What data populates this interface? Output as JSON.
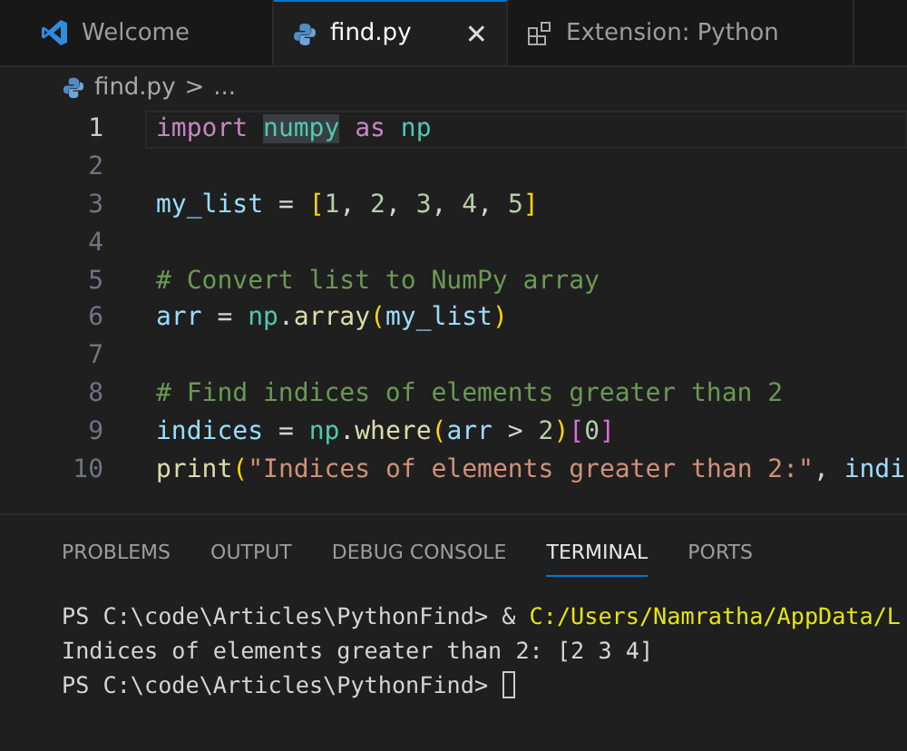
{
  "editor_tabs": [
    {
      "label": "Welcome",
      "selected": false
    },
    {
      "label": "find.py",
      "selected": true,
      "close": "✕"
    },
    {
      "label": "Extension: Python",
      "selected": false
    }
  ],
  "breadcrumb": {
    "file": "find.py",
    "separator": ">",
    "rest": "..."
  },
  "code_lines": [
    {
      "number": "1",
      "current": true,
      "tokens": [
        {
          "kind": "keyword",
          "text": "import "
        },
        {
          "kind": "module",
          "text": "numpy",
          "highlighted": true
        },
        {
          "kind": "keyword",
          "text": " as "
        },
        {
          "kind": "module",
          "text": "np"
        }
      ]
    },
    {
      "number": "2",
      "current": false
    },
    {
      "number": "3",
      "current": false,
      "tokens": [
        {
          "kind": "variable",
          "text": "my_list"
        },
        {
          "kind": "plain",
          "text": " = "
        },
        {
          "kind": "bracket",
          "text": "["
        },
        {
          "kind": "number",
          "text": "1"
        },
        {
          "kind": "plain",
          "text": ", "
        },
        {
          "kind": "number",
          "text": "2"
        },
        {
          "kind": "plain",
          "text": ", "
        },
        {
          "kind": "number",
          "text": "3"
        },
        {
          "kind": "plain",
          "text": ", "
        },
        {
          "kind": "number",
          "text": "4"
        },
        {
          "kind": "plain",
          "text": ", "
        },
        {
          "kind": "number",
          "text": "5"
        },
        {
          "kind": "bracket",
          "text": "]"
        }
      ]
    },
    {
      "number": "4",
      "current": false
    },
    {
      "number": "5",
      "current": false,
      "tokens": [
        {
          "kind": "comment",
          "text": "# Convert list to NumPy array"
        }
      ]
    },
    {
      "number": "6",
      "current": false,
      "tokens": [
        {
          "kind": "variable",
          "text": "arr"
        },
        {
          "kind": "plain",
          "text": " = "
        },
        {
          "kind": "module",
          "text": "np"
        },
        {
          "kind": "plain",
          "text": "."
        },
        {
          "kind": "function",
          "text": "array"
        },
        {
          "kind": "bracket",
          "text": "("
        },
        {
          "kind": "variable",
          "text": "my_list"
        },
        {
          "kind": "bracket",
          "text": ")"
        }
      ]
    },
    {
      "number": "7",
      "current": false
    },
    {
      "number": "8",
      "current": false,
      "tokens": [
        {
          "kind": "comment",
          "text": "# Find indices of elements greater than 2"
        }
      ]
    },
    {
      "number": "9",
      "current": false,
      "tokens": [
        {
          "kind": "variable",
          "text": "indices"
        },
        {
          "kind": "plain",
          "text": " = "
        },
        {
          "kind": "module",
          "text": "np"
        },
        {
          "kind": "plain",
          "text": "."
        },
        {
          "kind": "function",
          "text": "where"
        },
        {
          "kind": "bracket",
          "text": "("
        },
        {
          "kind": "variable",
          "text": "arr"
        },
        {
          "kind": "plain",
          "text": " > "
        },
        {
          "kind": "number",
          "text": "2"
        },
        {
          "kind": "bracket",
          "text": ")"
        },
        {
          "kind": "bracket2",
          "text": "["
        },
        {
          "kind": "number",
          "text": "0"
        },
        {
          "kind": "bracket2",
          "text": "]"
        }
      ]
    },
    {
      "number": "10",
      "current": false,
      "tokens": [
        {
          "kind": "function",
          "text": "print"
        },
        {
          "kind": "bracket",
          "text": "("
        },
        {
          "kind": "string",
          "text": "\"Indices of elements greater than 2:\""
        },
        {
          "kind": "plain",
          "text": ", "
        },
        {
          "kind": "variable",
          "text": "indi"
        }
      ]
    }
  ],
  "panel_tabs": [
    {
      "label": "PROBLEMS",
      "selected": false
    },
    {
      "label": "OUTPUT",
      "selected": false
    },
    {
      "label": "DEBUG CONSOLE",
      "selected": false
    },
    {
      "label": "TERMINAL",
      "selected": true
    },
    {
      "label": "PORTS",
      "selected": false
    }
  ],
  "terminal_lines": [
    {
      "cursor": false,
      "segments": [
        {
          "kind": "plain",
          "text": "PS C:\\code\\Articles\\PythonFind> & "
        },
        {
          "kind": "path",
          "text": "C:/Users/Namratha/AppData/L"
        }
      ]
    },
    {
      "cursor": false,
      "segments": [
        {
          "kind": "plain",
          "text": "Indices of elements greater than 2: [2 3 4]"
        }
      ]
    },
    {
      "cursor": true,
      "segments": [
        {
          "kind": "plain",
          "text": "PS C:\\code\\Articles\\PythonFind> "
        }
      ]
    }
  ]
}
